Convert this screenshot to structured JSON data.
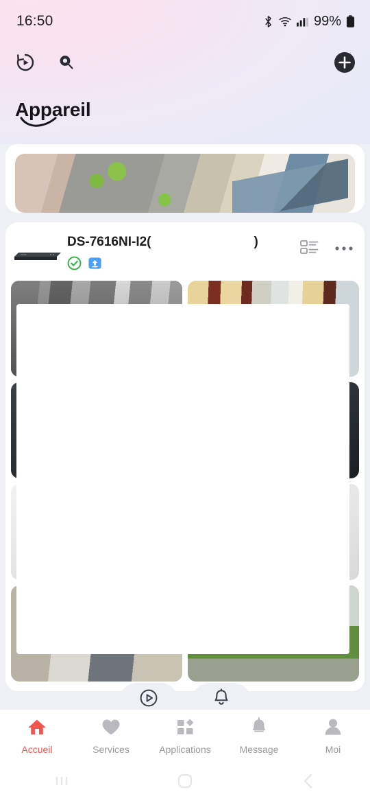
{
  "status_bar": {
    "time": "16:50",
    "battery_percent": "99%",
    "icons": [
      "bluetooth-icon",
      "wifi-icon",
      "cellular-signal-icon",
      "battery-icon"
    ]
  },
  "header": {
    "title": "Appareil",
    "history_icon": "playback-history-icon",
    "search_icon": "search-icon",
    "add_icon": "add-device-icon"
  },
  "colors": {
    "accent": "#f2564e",
    "online": "#2fb344",
    "upgrade_badge": "#4a9ff5",
    "page_bg": "#eef0f6",
    "card_bg": "#ffffff"
  },
  "cards": {
    "top_preview": {
      "name": "camera-preview-patio",
      "scene": "outdoor paving / patio"
    },
    "device": {
      "name": "DS-7616NI-I2(",
      "name_suffix": ")",
      "thumbnail": "nvr-device-icon",
      "status_badge": "online-check-icon",
      "upgrade_badge": "firmware-upgrade-icon",
      "list_view_icon": "list-view-toggle-icon",
      "more_icon": "more-options-icon",
      "cameras": [
        {
          "label": "camera-tile-1",
          "scene": "ir"
        },
        {
          "label": "camera-tile-2",
          "scene": "hall"
        },
        {
          "label": "camera-tile-3",
          "scene": "dark"
        },
        {
          "label": "camera-tile-4",
          "scene": "dark"
        },
        {
          "label": "camera-tile-5",
          "scene": "bright"
        },
        {
          "label": "camera-tile-6",
          "scene": "bright"
        },
        {
          "label": "camera-tile-7",
          "scene": "room"
        },
        {
          "label": "camera-tile-8",
          "scene": "garden"
        }
      ]
    }
  },
  "floating_buttons": [
    {
      "name": "live-view-button",
      "icon": "play-circle-icon"
    },
    {
      "name": "alarm-button",
      "icon": "bell-icon"
    }
  ],
  "tabbar": {
    "items": [
      {
        "label": "Accueil",
        "icon": "home-icon",
        "active": true
      },
      {
        "label": "Services",
        "icon": "heart-icon",
        "active": false
      },
      {
        "label": "Applications",
        "icon": "grid-apps-icon",
        "active": false
      },
      {
        "label": "Message",
        "icon": "bell-icon",
        "active": false
      },
      {
        "label": "Moi",
        "icon": "person-icon",
        "active": false
      }
    ]
  },
  "system_nav": {
    "recents": "recents-icon",
    "home": "home-square-icon",
    "back": "back-chevron-icon"
  }
}
